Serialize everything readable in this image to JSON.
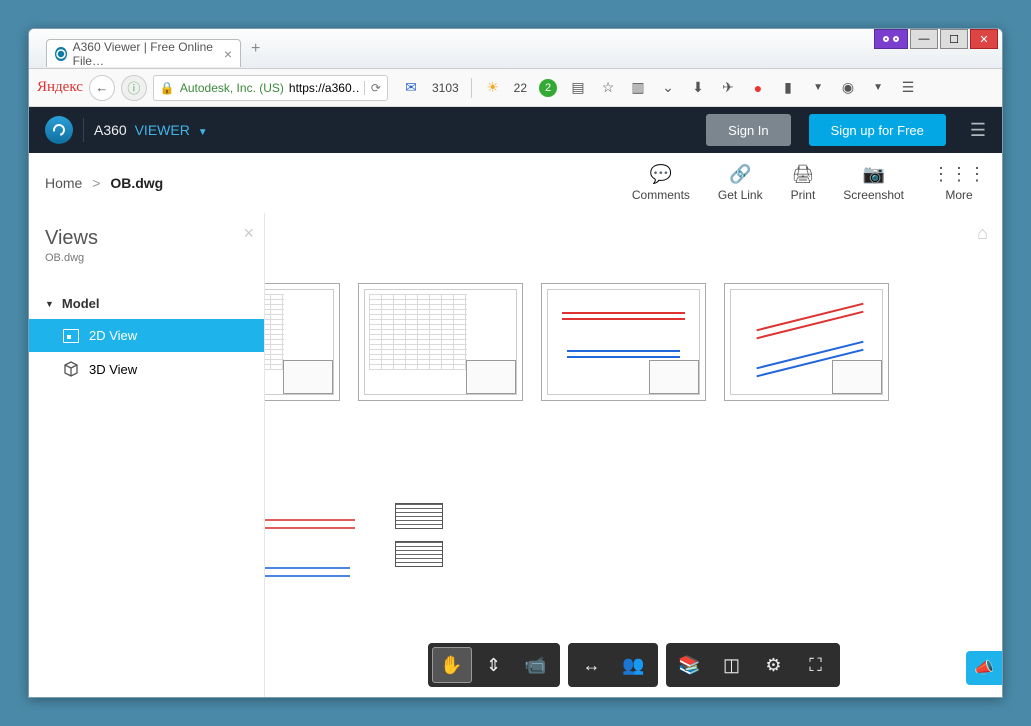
{
  "window": {
    "tab_title": "A360 Viewer | Free Online File…"
  },
  "addressbar": {
    "search_label": "Яндекс",
    "org": "Autodesk, Inc. (US)",
    "url": "https://a360…",
    "mail_count": "3103",
    "weather_temp": "22"
  },
  "app": {
    "brand": "A360",
    "brand_sub": "VIEWER",
    "signin": "Sign In",
    "signup": "Sign up for Free"
  },
  "breadcrumb": {
    "home": "Home",
    "sep": ">",
    "current": "OB.dwg"
  },
  "tools": {
    "comments": "Comments",
    "getlink": "Get Link",
    "print": "Print",
    "screenshot": "Screenshot",
    "more": "More"
  },
  "sidebar": {
    "heading": "Views",
    "filename": "OB.dwg",
    "model": "Model",
    "view2d": "2D View",
    "view3d": "3D View"
  }
}
